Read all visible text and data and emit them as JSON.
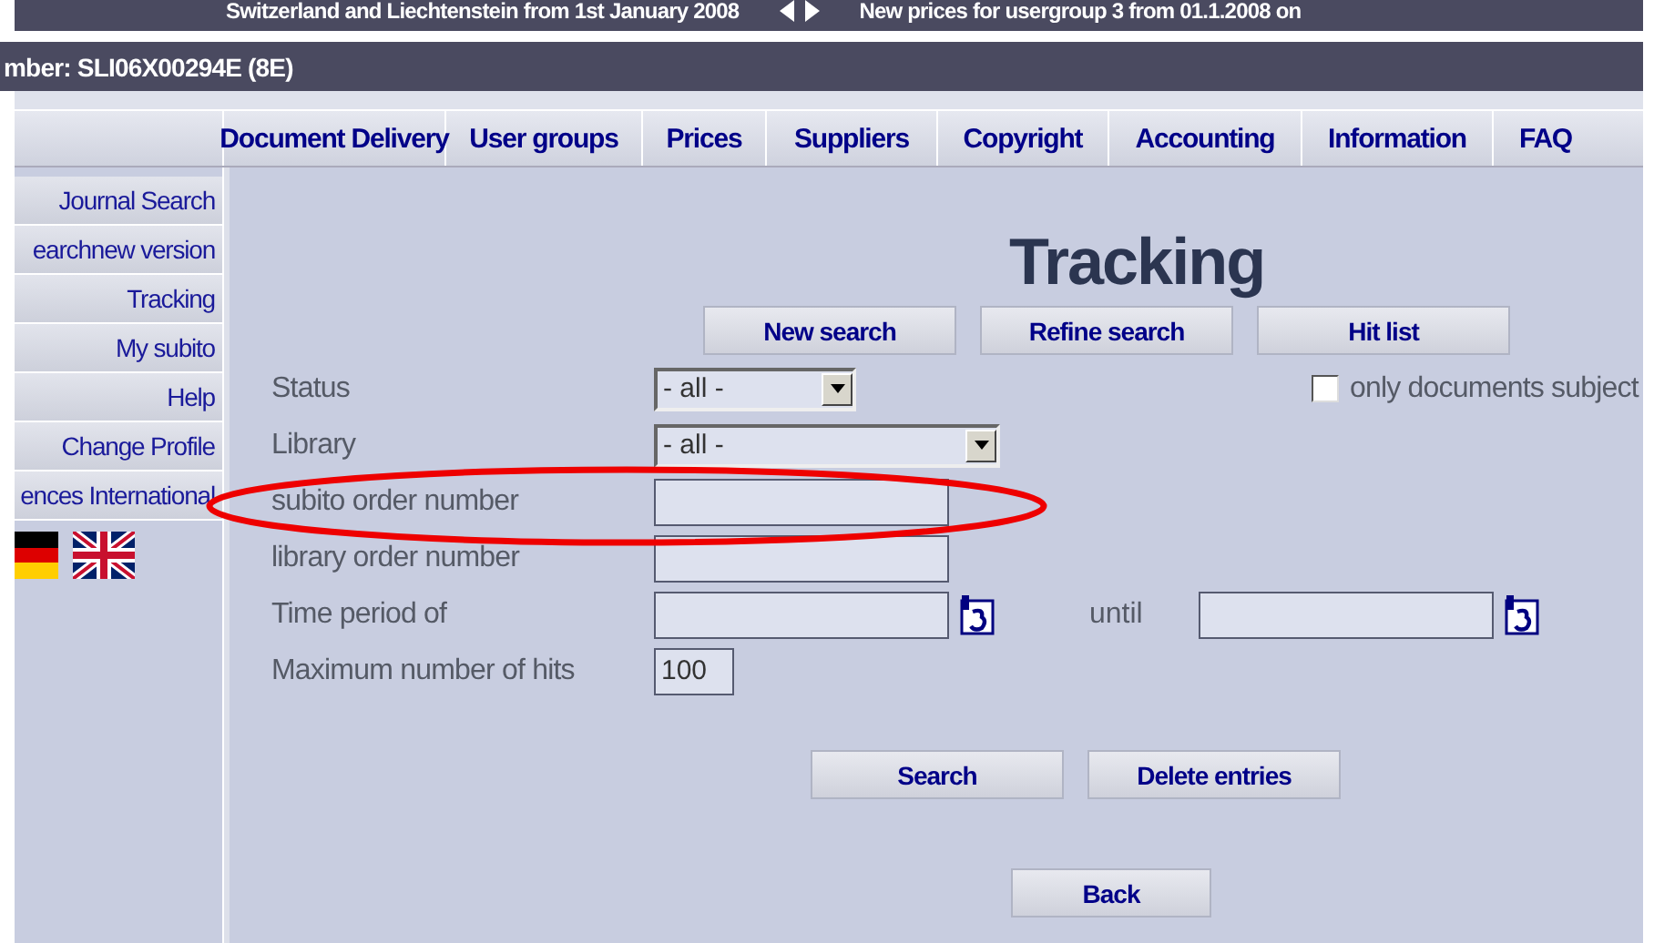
{
  "ticker": {
    "left": "Switzerland and Liechtenstein from 1st January 2008",
    "right": "New prices for usergroup 3 from 01.1.2008 on"
  },
  "header": {
    "text": "mber: SLI06X00294E (8E)"
  },
  "nav": [
    "Document Delivery",
    "User groups",
    "Prices",
    "Suppliers",
    "Copyright",
    "Accounting",
    "Information",
    "FAQ"
  ],
  "sidebar": [
    "Journal Search",
    "earchnew version",
    "Tracking",
    "My subito",
    "Help",
    "Change Profile",
    "ences International"
  ],
  "title": "Tracking",
  "top_buttons": [
    "New search",
    "Refine search",
    "Hit list"
  ],
  "form": {
    "status": {
      "label": "Status",
      "value": "- all -"
    },
    "only_documents": {
      "label": "only documents subject",
      "checked": false
    },
    "library": {
      "label": "Library",
      "value": "- all -"
    },
    "subito_order_number": {
      "label": "subito order number"
    },
    "library_order_number": {
      "label": "library order number"
    },
    "time_period": {
      "label": "Time period of",
      "until": "until"
    },
    "max_hits": {
      "label": "Maximum number of hits",
      "value": "100"
    }
  },
  "bottom_buttons": [
    "Search",
    "Delete entries"
  ],
  "back": "Back"
}
